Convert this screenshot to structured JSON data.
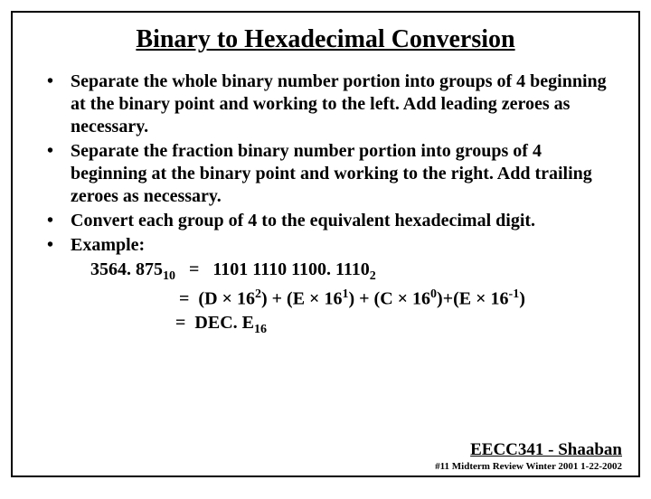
{
  "title": "Binary to Hexadecimal Conversion",
  "bullets": [
    "Separate the whole binary number portion into groups of 4 beginning at the binary point and working to the left. Add leading zeroes as necessary.",
    "Separate the fraction binary number portion into groups of 4  beginning at the binary point and working to the right.  Add trailing zeroes as necessary.",
    "Convert each group of  4  to the equivalent hexadecimal digit.",
    "Example:"
  ],
  "example": {
    "decimal_value": "3564. 875",
    "decimal_base": "10",
    "binary_value": "1101 1110 1100. 1110",
    "binary_base": "2",
    "expand_d": "D",
    "exp_d": "2",
    "expand_e": "E",
    "exp_e": "1",
    "expand_c": "C",
    "exp_c": "0",
    "expand_e2": "E",
    "exp_e2": "-1",
    "radix": "16",
    "hex_value": "DEC. E",
    "hex_base": "16",
    "eq": "=",
    "times": "×",
    "plus": "+",
    "lp": "(",
    "rp": ")"
  },
  "footer": {
    "main": "EECC341 - Shaaban",
    "sub": "#11   Midterm Review   Winter 2001  1-22-2002"
  }
}
